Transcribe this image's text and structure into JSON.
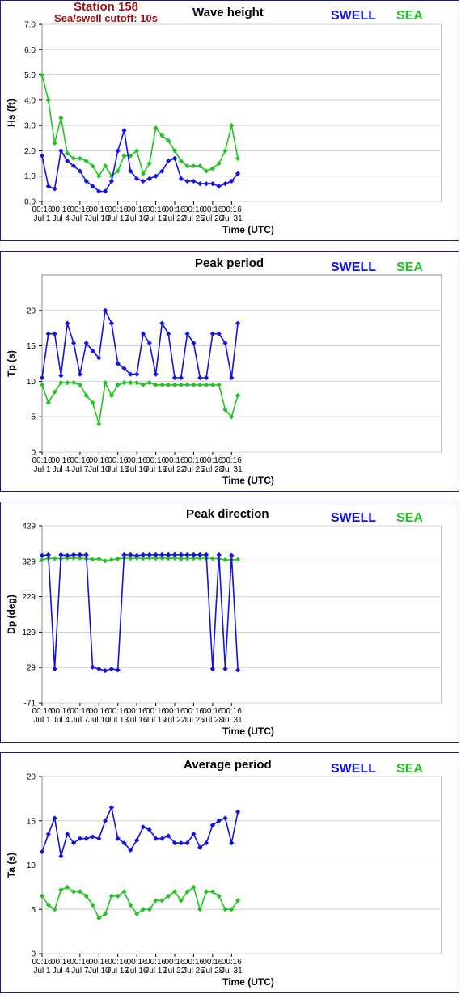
{
  "header": {
    "station": "Station 158",
    "cutoff": "Sea/swell cutoff: 10s"
  },
  "legend": {
    "swell": "SWELL",
    "sea": "SEA"
  },
  "colors": {
    "swell": "#1212e6",
    "sea": "#22c322",
    "frame": "#1a1a8a",
    "header": "#9b1010"
  },
  "x_ticks": [
    {
      "time": "00:16",
      "date": "Jul 1"
    },
    {
      "time": "00:16",
      "date": "Jul 4"
    },
    {
      "time": "00:16",
      "date": "Jul 7"
    },
    {
      "time": "00:16",
      "date": "Jul 10"
    },
    {
      "time": "00:16",
      "date": "Jul 13"
    },
    {
      "time": "00:16",
      "date": "Jul 16"
    },
    {
      "time": "00:16",
      "date": "Jul 19"
    },
    {
      "time": "00:16",
      "date": "Jul 22"
    },
    {
      "time": "00:16",
      "date": "Jul 25"
    },
    {
      "time": "00:16",
      "date": "Jul 28"
    },
    {
      "time": "00:16",
      "date": "Jul 31"
    }
  ],
  "xlabel": "Time (UTC)",
  "chart_data": [
    {
      "type": "line",
      "title": "Wave height",
      "ylabel": "Hs (ft)",
      "ylim": [
        0,
        7
      ],
      "yticks": [
        "0.0",
        "1.0",
        "2.0",
        "3.0",
        "4.0",
        "5.0",
        "6.0",
        "7.0"
      ],
      "grid": true,
      "legend_position": "top-right",
      "x": [
        "Jul 1",
        "Jul 2",
        "Jul 3",
        "Jul 4",
        "Jul 5",
        "Jul 6",
        "Jul 7",
        "Jul 8",
        "Jul 9",
        "Jul 10",
        "Jul 11",
        "Jul 12",
        "Jul 13",
        "Jul 14",
        "Jul 15",
        "Jul 16",
        "Jul 17",
        "Jul 18",
        "Jul 19",
        "Jul 20",
        "Jul 21",
        "Jul 22",
        "Jul 23",
        "Jul 24",
        "Jul 25",
        "Jul 26",
        "Jul 27",
        "Jul 28",
        "Jul 29",
        "Jul 30",
        "Jul 31",
        "Aug 1"
      ],
      "series": [
        {
          "name": "SWELL",
          "values": [
            1.8,
            0.6,
            0.5,
            2.0,
            1.6,
            1.4,
            1.2,
            0.8,
            0.6,
            0.4,
            0.4,
            0.8,
            2.0,
            2.8,
            1.2,
            0.9,
            0.8,
            0.9,
            1.0,
            1.2,
            1.6,
            1.7,
            0.9,
            0.8,
            0.8,
            0.7,
            0.7,
            0.7,
            0.6,
            0.7,
            0.8,
            1.1
          ]
        },
        {
          "name": "SEA",
          "values": [
            5.0,
            4.0,
            2.3,
            3.3,
            1.9,
            1.7,
            1.7,
            1.6,
            1.4,
            1.0,
            1.4,
            1.0,
            1.2,
            1.8,
            1.8,
            2.0,
            1.1,
            1.5,
            2.9,
            2.6,
            2.4,
            2.0,
            1.6,
            1.4,
            1.4,
            1.4,
            1.2,
            1.3,
            1.5,
            2.0,
            3.0,
            1.7
          ]
        }
      ]
    },
    {
      "type": "line",
      "title": "Peak period",
      "ylabel": "Tp (s)",
      "ylim": [
        0,
        25
      ],
      "yticks": [
        "0",
        "5",
        "10",
        "15",
        "20"
      ],
      "grid": true,
      "legend_position": "top-right",
      "x": [
        "Jul 1",
        "Jul 2",
        "Jul 3",
        "Jul 4",
        "Jul 5",
        "Jul 6",
        "Jul 7",
        "Jul 8",
        "Jul 9",
        "Jul 10",
        "Jul 11",
        "Jul 12",
        "Jul 13",
        "Jul 14",
        "Jul 15",
        "Jul 16",
        "Jul 17",
        "Jul 18",
        "Jul 19",
        "Jul 20",
        "Jul 21",
        "Jul 22",
        "Jul 23",
        "Jul 24",
        "Jul 25",
        "Jul 26",
        "Jul 27",
        "Jul 28",
        "Jul 29",
        "Jul 30",
        "Jul 31",
        "Aug 1"
      ],
      "series": [
        {
          "name": "SWELL",
          "values": [
            10.5,
            16.7,
            16.7,
            10.8,
            18.2,
            15.4,
            11.0,
            15.4,
            14.3,
            13.3,
            20.0,
            18.2,
            12.5,
            11.8,
            11.0,
            11.0,
            16.7,
            15.4,
            11.0,
            18.2,
            16.7,
            10.5,
            10.5,
            16.7,
            15.4,
            10.5,
            10.5,
            16.7,
            16.7,
            15.4,
            10.5,
            18.2
          ]
        },
        {
          "name": "SEA",
          "values": [
            9.5,
            7.0,
            8.5,
            9.8,
            9.8,
            9.8,
            9.5,
            8.0,
            7.0,
            4.0,
            9.8,
            8.0,
            9.5,
            9.8,
            9.8,
            9.8,
            9.5,
            9.8,
            9.5,
            9.5,
            9.5,
            9.5,
            9.5,
            9.5,
            9.5,
            9.5,
            9.5,
            9.5,
            9.5,
            6.0,
            5.0,
            8.0
          ]
        }
      ]
    },
    {
      "type": "line",
      "title": "Peak direction",
      "ylabel": "Dp (deg)",
      "ylim": [
        -71,
        429
      ],
      "yticks": [
        "-71",
        "29",
        "129",
        "229",
        "329",
        "429"
      ],
      "grid": true,
      "legend_position": "top-right",
      "x": [
        "Jul 1",
        "Jul 2",
        "Jul 3",
        "Jul 4",
        "Jul 5",
        "Jul 6",
        "Jul 7",
        "Jul 8",
        "Jul 9",
        "Jul 10",
        "Jul 11",
        "Jul 12",
        "Jul 13",
        "Jul 14",
        "Jul 15",
        "Jul 16",
        "Jul 17",
        "Jul 18",
        "Jul 19",
        "Jul 20",
        "Jul 21",
        "Jul 22",
        "Jul 23",
        "Jul 24",
        "Jul 25",
        "Jul 26",
        "Jul 27",
        "Jul 28",
        "Jul 29",
        "Jul 30",
        "Jul 31",
        "Aug 1"
      ],
      "series": [
        {
          "name": "SWELL",
          "values": [
            345,
            347,
            25,
            347,
            345,
            347,
            347,
            347,
            30,
            25,
            20,
            25,
            22,
            347,
            347,
            345,
            347,
            347,
            347,
            347,
            347,
            347,
            347,
            347,
            347,
            347,
            347,
            25,
            347,
            25,
            345,
            22
          ]
        },
        {
          "name": "SEA",
          "values": [
            333,
            337,
            337,
            336,
            338,
            338,
            338,
            336,
            334,
            336,
            330,
            333,
            336,
            338,
            337,
            338,
            337,
            338,
            337,
            338,
            337,
            338,
            336,
            337,
            337,
            338,
            337,
            337,
            336,
            333,
            333,
            334
          ]
        }
      ]
    },
    {
      "type": "line",
      "title": "Average period",
      "ylabel": "Ta (s)",
      "ylim": [
        0,
        20
      ],
      "yticks": [
        "0",
        "5",
        "10",
        "15",
        "20"
      ],
      "grid": true,
      "legend_position": "top-right",
      "x": [
        "Jul 1",
        "Jul 2",
        "Jul 3",
        "Jul 4",
        "Jul 5",
        "Jul 6",
        "Jul 7",
        "Jul 8",
        "Jul 9",
        "Jul 10",
        "Jul 11",
        "Jul 12",
        "Jul 13",
        "Jul 14",
        "Jul 15",
        "Jul 16",
        "Jul 17",
        "Jul 18",
        "Jul 19",
        "Jul 20",
        "Jul 21",
        "Jul 22",
        "Jul 23",
        "Jul 24",
        "Jul 25",
        "Jul 26",
        "Jul 27",
        "Jul 28",
        "Jul 29",
        "Jul 30",
        "Jul 31",
        "Aug 1"
      ],
      "series": [
        {
          "name": "SWELL",
          "values": [
            11.5,
            13.5,
            15.3,
            11.0,
            13.5,
            12.5,
            13.0,
            13.0,
            13.2,
            13.0,
            15.0,
            16.5,
            13.0,
            12.5,
            11.7,
            12.8,
            14.3,
            14.0,
            13.0,
            13.0,
            13.3,
            12.5,
            12.5,
            12.5,
            13.5,
            12.0,
            12.5,
            14.5,
            15.0,
            15.3,
            12.5,
            16.0
          ]
        },
        {
          "name": "SEA",
          "values": [
            6.5,
            5.5,
            5.0,
            7.2,
            7.5,
            7.0,
            7.0,
            6.5,
            5.5,
            4.0,
            4.5,
            6.5,
            6.5,
            7.0,
            5.5,
            4.5,
            5.0,
            5.0,
            6.0,
            6.0,
            6.5,
            7.0,
            6.0,
            7.0,
            7.5,
            5.0,
            7.0,
            7.0,
            6.5,
            5.0,
            5.0,
            6.0
          ]
        }
      ]
    }
  ]
}
